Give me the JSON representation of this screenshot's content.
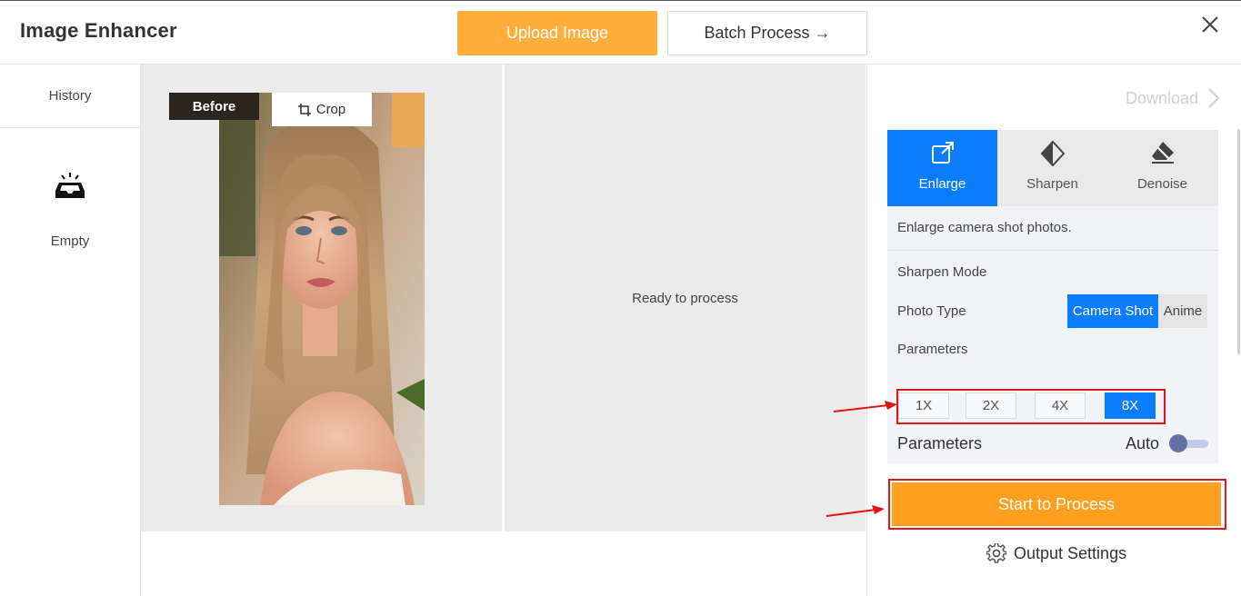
{
  "header": {
    "title": "Image Enhancer",
    "upload_label": "Upload Image",
    "batch_label": "Batch Process →",
    "close_icon": "close-icon"
  },
  "sidebar": {
    "history_label": "History",
    "empty_icon": "empty-tray-icon",
    "empty_label": "Empty"
  },
  "canvas": {
    "before_label": "Before",
    "crop_label": "Crop",
    "ready_text": "Ready to process"
  },
  "right_panel": {
    "download_label": "Download",
    "tabs": [
      {
        "label": "Enlarge",
        "icon": "enlarge-icon",
        "active": true
      },
      {
        "label": "Sharpen",
        "icon": "sharpen-icon",
        "active": false
      },
      {
        "label": "Denoise",
        "icon": "eraser-icon",
        "active": false
      }
    ],
    "description": "Enlarge camera shot photos.",
    "sharpen_mode_label": "Sharpen Mode",
    "photo_type_label": "Photo Type",
    "photo_types": [
      "Camera Shot",
      "Anime"
    ],
    "photo_type_selected": "Camera Shot",
    "parameters_label": "Parameters",
    "scales": [
      "1X",
      "2X",
      "4X",
      "8X"
    ],
    "scale_selected": "8X",
    "parameters_label_2": "Parameters",
    "auto_label": "Auto",
    "auto_enabled": false,
    "process_label": "Start to Process",
    "output_settings_label": "Output Settings"
  },
  "colors": {
    "accent_blue": "#0a7dff",
    "upload_orange": "#ffad3b",
    "process_orange": "#ff9f1f",
    "annotation_red": "#e01515"
  }
}
